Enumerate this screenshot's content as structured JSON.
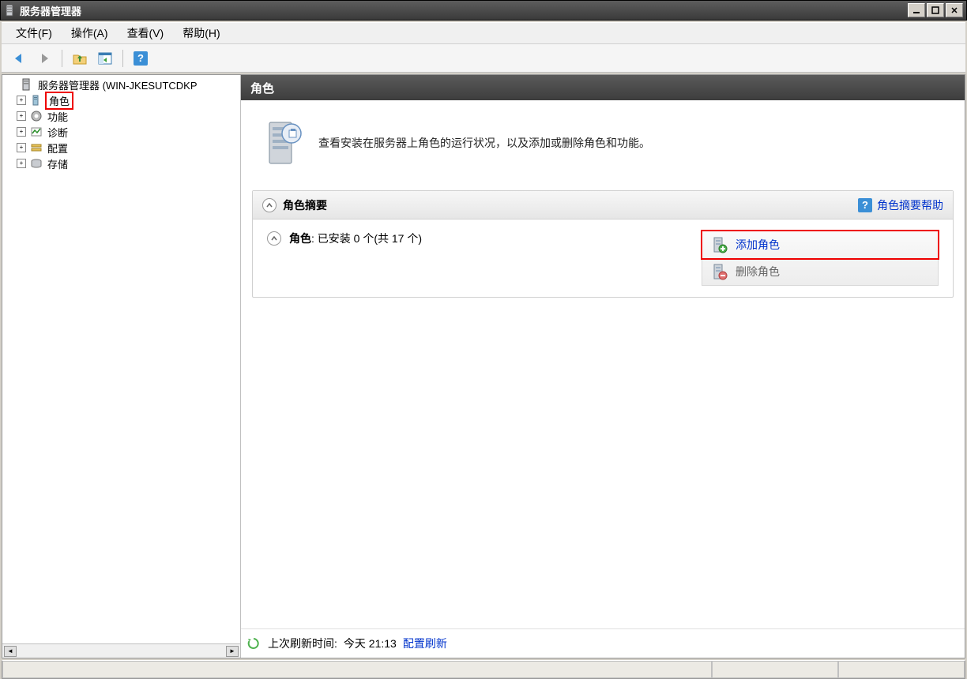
{
  "title_bar": {
    "title": "服务器管理器"
  },
  "window_controls": {
    "minimize": "_",
    "maximize": "▭",
    "close": "✕"
  },
  "menu": {
    "file": "文件(F)",
    "action": "操作(A)",
    "view": "查看(V)",
    "help": "帮助(H)"
  },
  "tree": {
    "root": "服务器管理器 (WIN-JKESUTCDKP",
    "items": [
      {
        "label": "角色"
      },
      {
        "label": "功能"
      },
      {
        "label": "诊断"
      },
      {
        "label": "配置"
      },
      {
        "label": "存储"
      }
    ]
  },
  "content": {
    "header": "角色",
    "intro": "查看安装在服务器上角色的运行状况，以及添加或删除角色和功能。",
    "section_title": "角色摘要",
    "help_link": "角色摘要帮助",
    "roles_label": "角色",
    "roles_status": ": 已安装 0 个(共 17 个)",
    "action_add": "添加角色",
    "action_remove": "删除角色",
    "last_refresh_label": "上次刷新时间:",
    "last_refresh_value": "今天 21:13",
    "configure_refresh": "配置刷新"
  }
}
